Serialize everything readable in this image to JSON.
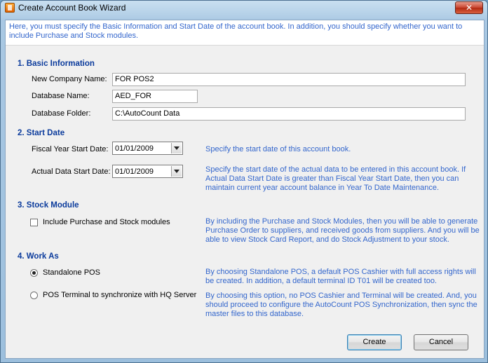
{
  "window": {
    "title": "Create Account Book Wizard",
    "close_symbol": "✕"
  },
  "header": {
    "text": "Here, you must specify the Basic Information and Start Date of the account book. In addition, you should specify whether you want to include Purchase and Stock modules."
  },
  "basic_info": {
    "title": "1. Basic Information",
    "company_label": "New Company Name:",
    "company_value": "FOR POS2",
    "db_name_label": "Database Name:",
    "db_name_value": "AED_FOR",
    "db_folder_label": "Database Folder:",
    "db_folder_value": "C:\\AutoCount Data"
  },
  "start_date": {
    "title": "2. Start Date",
    "fiscal_label": "Fiscal Year Start Date:",
    "fiscal_value": "01/01/2009",
    "fiscal_hint": "Specify the start date of this account book.",
    "actual_label": "Actual Data Start Date:",
    "actual_value": "01/01/2009",
    "actual_hint": "Specify the start date of the actual data to be entered in this account book. If Actual Data Start Date is greater than Fiscal Year Start Date, then you can maintain current year account balance in Year To Date Maintenance."
  },
  "stock_module": {
    "title": "3. Stock Module",
    "checkbox_label": "Include Purchase and Stock modules",
    "checked": false,
    "hint": "By including the Purchase and Stock Modules, then you will be able to generate Purchase Order to suppliers, and received goods from suppliers. And you will be able to view Stock Card Report, and do Stock Adjustment to your stock."
  },
  "work_as": {
    "title": "4. Work As",
    "standalone_label": "Standalone POS",
    "standalone_hint": "By choosing Standalone POS, a default POS Cashier with full access rights will be created. In addition, a default terminal ID T01 will be created too.",
    "terminal_label": "POS Terminal to synchronize with HQ Server",
    "terminal_hint": "By choosing this option, no POS Cashier and Terminal will be created. And, you should proceed to configure the AutoCount POS Synchronization, then sync the master files to this database.",
    "selected": "standalone"
  },
  "buttons": {
    "create": "Create",
    "cancel": "Cancel"
  }
}
